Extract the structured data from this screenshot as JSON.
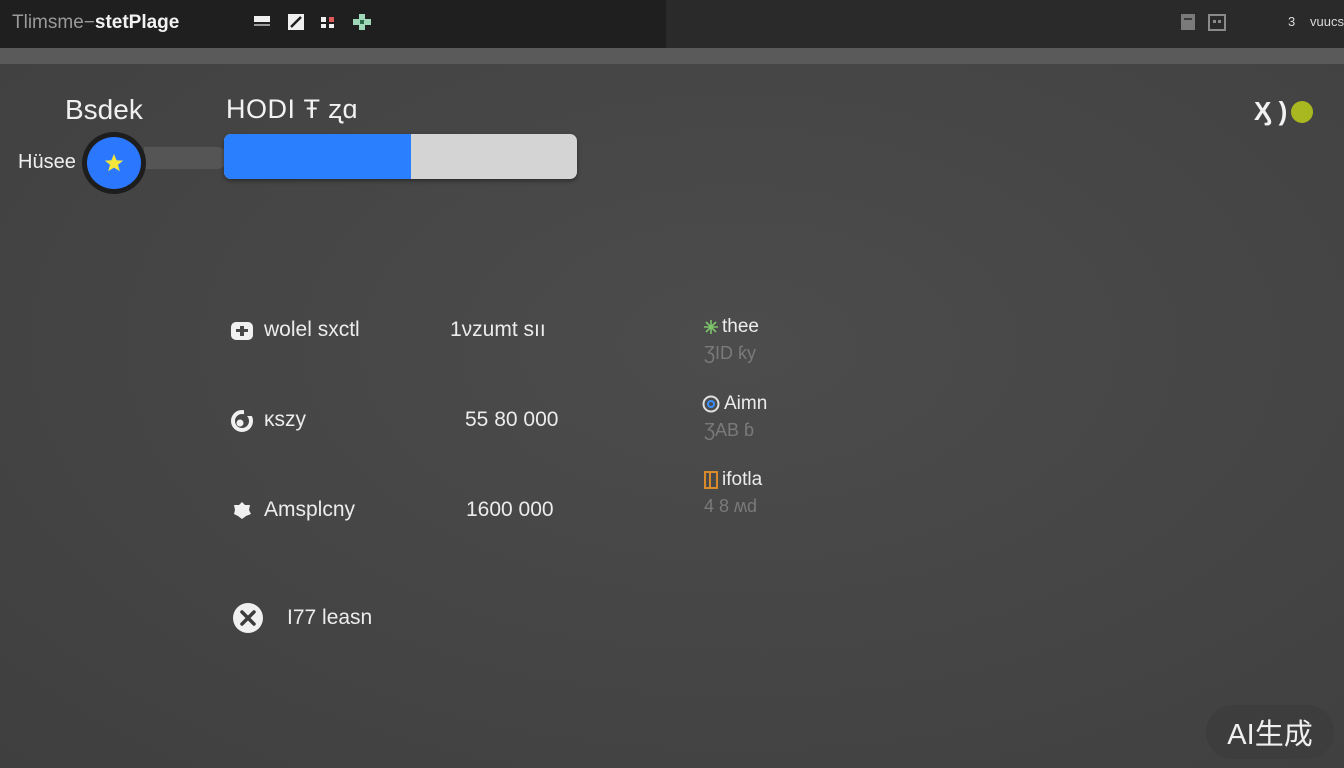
{
  "window": {
    "title_dim": "Tlimsme−",
    "title_bright": "stetPlage"
  },
  "toolbar": {
    "icons": [
      "minimize-icon",
      "edit-icon",
      "grid-icon",
      "add-icon"
    ]
  },
  "top_right": {
    "icons": [
      "document-icon",
      "calendar-icon"
    ],
    "status_number": "3",
    "status_label": "vuucs"
  },
  "sidebar": {
    "heading": "Bsdek",
    "home_label": "Hüsee",
    "home_icon": "star-icon"
  },
  "main": {
    "heading": "HODI Ŧ ʐɑ",
    "progress": {
      "percent": 53,
      "fill_color": "#2a7fff",
      "track_color": "#d4d4d4"
    },
    "corner_badge": "Ӽ )"
  },
  "rows": [
    {
      "icon": "folder-icon",
      "label": "wolel sxctl",
      "value": "1νzumt sıı"
    },
    {
      "icon": "refresh-icon",
      "label": "ĸszy",
      "value": "55 80 000"
    },
    {
      "icon": "gear-icon",
      "label": "Amsplcny",
      "value": "1600 000"
    },
    {
      "icon": "close-circle-icon",
      "label": "I77 leasn",
      "value": ""
    }
  ],
  "tags": [
    {
      "icon": "star-outline-icon",
      "icon_color": "#7cc36a",
      "title": "thee",
      "sub": "ƷID ƙy"
    },
    {
      "icon": "at-icon",
      "icon_color": "#e0e0e0",
      "title": "Aimn",
      "sub": "ƷAB ɓ"
    },
    {
      "icon": "bookmark-icon",
      "icon_color": "#d98b2b",
      "title": "ifotla",
      "sub": "4 8 ʍd"
    }
  ],
  "watermark": "AI生成"
}
